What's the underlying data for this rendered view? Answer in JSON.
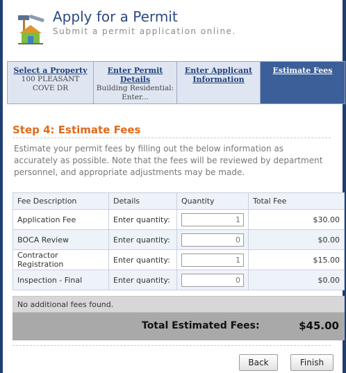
{
  "header": {
    "title": "Apply for a Permit",
    "subtitle": "Submit a permit application online."
  },
  "wizard": {
    "steps": [
      {
        "label": "Select a Property",
        "detail": "100 PLEASANT COVE DR"
      },
      {
        "label": "Enter Permit Details",
        "detail": "Building Residential: Enter..."
      },
      {
        "label": "Enter Applicant Information",
        "detail": ""
      },
      {
        "label": "Estimate Fees",
        "detail": ""
      }
    ],
    "active_index": 3
  },
  "step": {
    "heading": "Step 4: Estimate Fees",
    "intro": "Estimate your permit fees by filling out the below information as accurately as possible. Note that the fees will be reviewed by department personnel, and appropriate adjustments may be made."
  },
  "fees": {
    "columns": [
      "Fee Description",
      "Details",
      "Quantity",
      "Total Fee"
    ],
    "rows": [
      {
        "description": "Application Fee",
        "details": "Enter quantity:",
        "quantity": "1",
        "total": "$30.00"
      },
      {
        "description": "BOCA Review",
        "details": "Enter quantity:",
        "quantity": "0",
        "total": "$0.00"
      },
      {
        "description": "Contractor Registration",
        "details": "Enter quantity:",
        "quantity": "1",
        "total": "$15.00"
      },
      {
        "description": "Inspection - Final",
        "details": "Enter quantity:",
        "quantity": "0",
        "total": "$0.00"
      }
    ],
    "no_additional": "No additional fees found.",
    "total_label": "Total Estimated Fees:",
    "total_value": "$45.00"
  },
  "buttons": {
    "back": "Back",
    "finish": "Finish"
  },
  "colors": {
    "accent_heading": "#e06a1b",
    "active_step": "#3b5f99",
    "frame": "#1f3f73"
  },
  "icons": {
    "logo": "construction-permit-icon"
  }
}
